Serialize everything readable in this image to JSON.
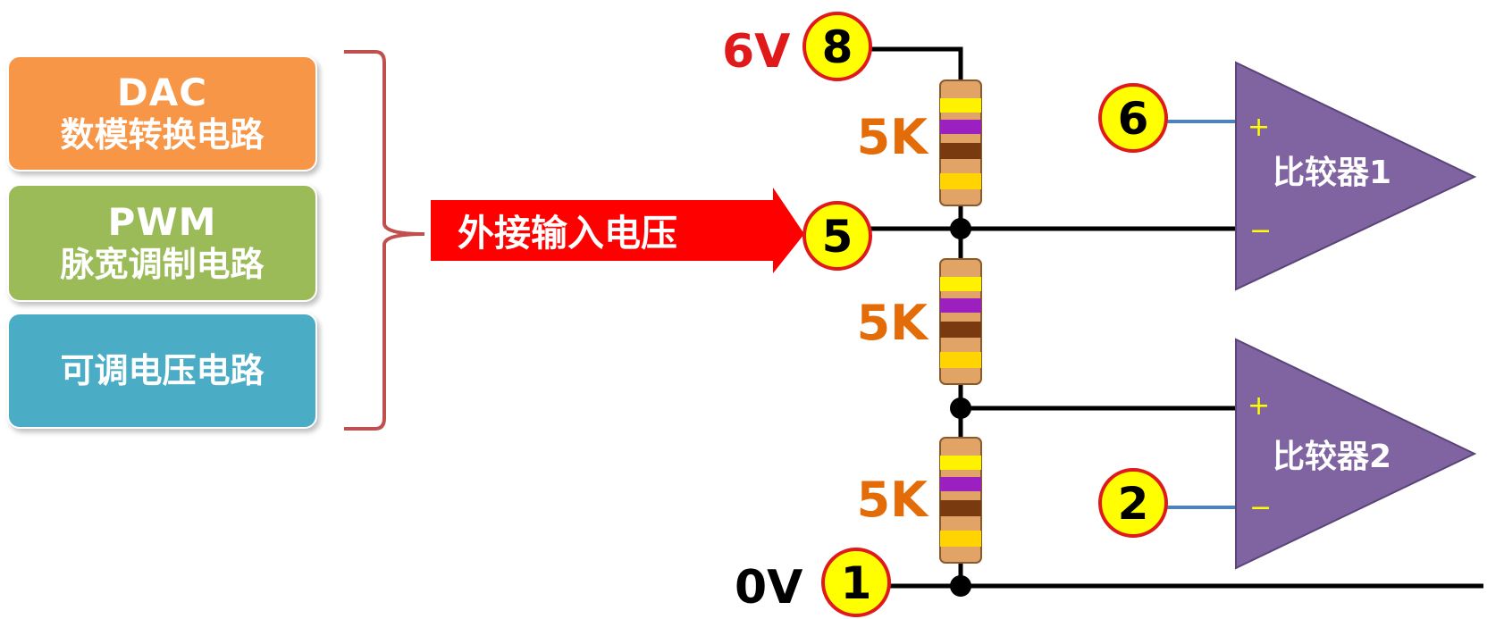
{
  "colors": {
    "box_dac": "#F79646",
    "box_pwm": "#9BBB59",
    "box_adj": "#4BACC6",
    "bracket": "#C0504D",
    "arrow": "#FF0000",
    "pin_fill": "#FFFF00",
    "pin_border": "#E0191B",
    "resistor_label": "#E36C09",
    "voltage_6v": "#E0191B",
    "comparator": "#8064A2",
    "comparator_sign": "#FFFF00",
    "input_wire": "#4F81BD"
  },
  "sources": {
    "dac": {
      "title": "DAC",
      "subtitle": "数模转换电路"
    },
    "pwm": {
      "title": "PWM",
      "subtitle": "脉宽调制电路"
    },
    "adj": {
      "title": "可调电压电路"
    }
  },
  "arrow_label": "外接输入电压",
  "pins": {
    "p8": "8",
    "p5": "5",
    "p6": "6",
    "p2": "2",
    "p1": "1"
  },
  "voltages": {
    "top": "6V",
    "bottom": "0V"
  },
  "resistors": [
    {
      "label": "5K"
    },
    {
      "label": "5K"
    },
    {
      "label": "5K"
    }
  ],
  "comparators": [
    {
      "label": "比较器1",
      "plus": "+",
      "minus": "−"
    },
    {
      "label": "比较器2",
      "plus": "+",
      "minus": "−"
    }
  ]
}
